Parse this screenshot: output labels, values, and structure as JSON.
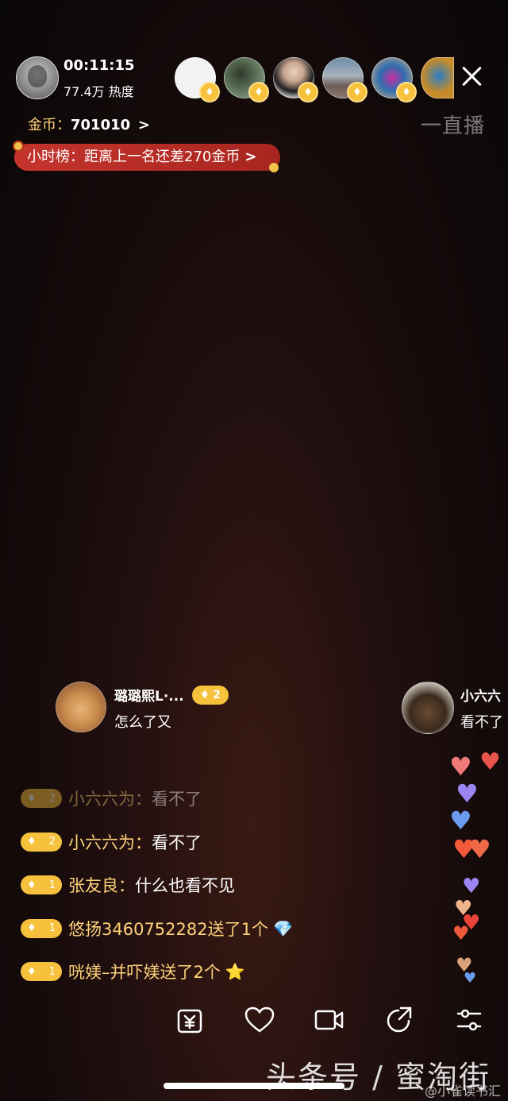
{
  "host": {
    "time": "00:11:15",
    "heat": "77.4万 热度"
  },
  "coins": {
    "label": "金币：",
    "value": "701010",
    "chevron": ">"
  },
  "hour_rank": {
    "text": "小时榜：距离上一名还差270金币",
    "chevron": ">"
  },
  "viewers": [
    {
      "badge": "♦"
    },
    {
      "badge": "♦"
    },
    {
      "badge": "♦"
    },
    {
      "badge": "♦"
    },
    {
      "badge": "♦"
    }
  ],
  "watermark_top": "一直播",
  "comment_cards": [
    {
      "name": "璐璐熙L·...",
      "level": "2",
      "text": "怎么了又"
    },
    {
      "name": "小六六",
      "text": "看不了"
    }
  ],
  "chat": [
    {
      "level": "2",
      "name": "小六六为：",
      "msg": "看不了",
      "faded": true
    },
    {
      "level": "2",
      "name": "小六六为：",
      "msg": "看不了"
    },
    {
      "level": "1",
      "name": "张友良：",
      "msg": "什么也看不见"
    },
    {
      "level": "1",
      "name": "悠扬3460752282送了1个",
      "msg": ""
    },
    {
      "level": "1",
      "name": "咣媄–并吓媄送了2个",
      "msg": ""
    }
  ],
  "watermark_bottom": "头条号 / 蜜淘街",
  "watermark_weibo": "@小雀读书汇",
  "colors": {
    "accent": "#f6c23d",
    "rank_bg": "#c4342d",
    "name_text": "#ffd27a"
  }
}
